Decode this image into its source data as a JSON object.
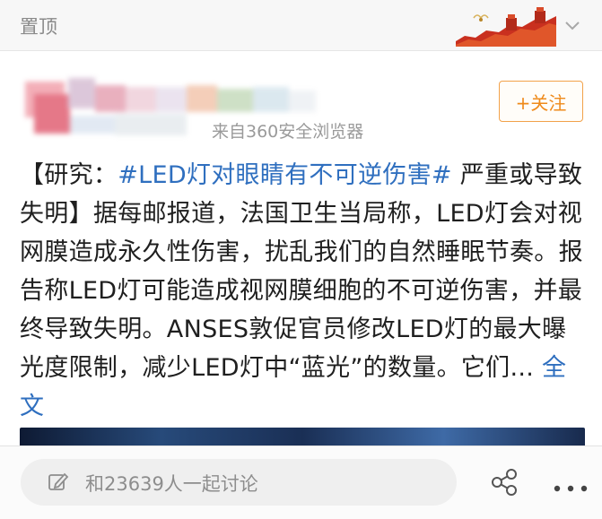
{
  "header": {
    "pin_label": "置顶"
  },
  "post": {
    "source": "来自360安全浏览器",
    "follow_label": "+关注",
    "text_prefix": "【研究：",
    "topic": "#LED灯对眼睛有不可逆伤害#",
    "text_body": " 严重或导致失明】据每邮报道，法国卫生当局称，LED灯会对视网膜造成永久性伤害，扰乱我们的自然睡眠节奏。报告称LED灯可能造成视网膜细胞的不可逆伤害，并最终导致失明。ANSES敦促官员修改LED灯的最大曝光度限制，减少LED灯中“蓝光”的数量。它们...",
    "more_label": "全文"
  },
  "footer": {
    "comment_placeholder": "和23639人一起讨论"
  },
  "icons": [
    "great-wall-banner",
    "chevron-down-icon",
    "pen-icon",
    "share-icon",
    "more-icon"
  ],
  "colors": {
    "accent_orange": "#ef8a1b",
    "link_blue": "#2f6fbf"
  }
}
